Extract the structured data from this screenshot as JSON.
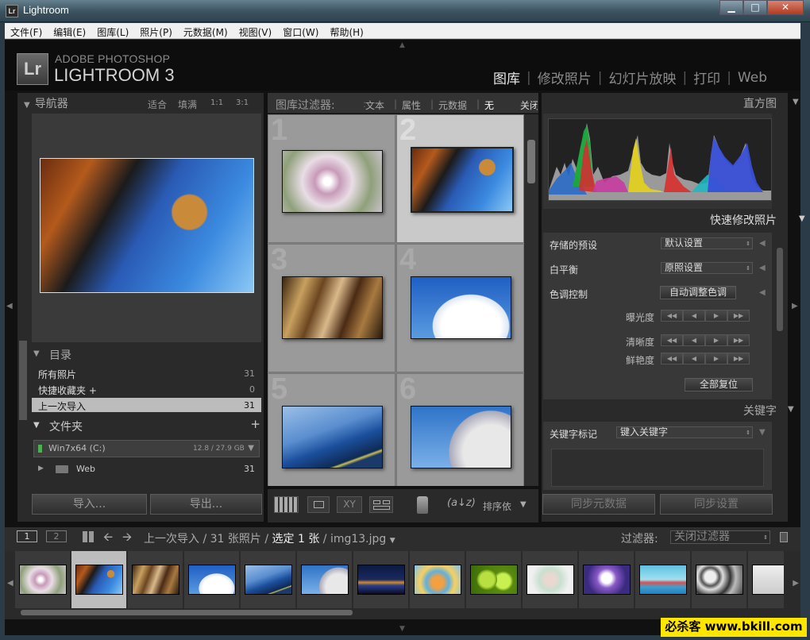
{
  "window": {
    "title": "Lightroom",
    "icon_label": "Lr",
    "min": "▁",
    "max": "□",
    "close": "✕"
  },
  "menu": [
    "文件(F)",
    "编辑(E)",
    "图库(L)",
    "照片(P)",
    "元数据(M)",
    "视图(V)",
    "窗口(W)",
    "帮助(H)"
  ],
  "brand": {
    "logo": "Lr",
    "line1": "ADOBE PHOTOSHOP",
    "line2": "LIGHTROOM 3"
  },
  "modules": [
    {
      "label": "图库",
      "active": true
    },
    {
      "label": "修改照片",
      "active": false
    },
    {
      "label": "幻灯片放映",
      "active": false
    },
    {
      "label": "打印",
      "active": false
    },
    {
      "label": "Web",
      "active": false
    }
  ],
  "navigator": {
    "title": "导航器",
    "opts": [
      "适合",
      "填满",
      "1:1",
      "3:1"
    ]
  },
  "catalog": {
    "title": "目录",
    "items": [
      {
        "label": "所有照片",
        "count": "31"
      },
      {
        "label": "快捷收藏夹 +",
        "count": "0"
      },
      {
        "label": "上一次导入",
        "count": "31"
      }
    ]
  },
  "folders": {
    "title": "文件夹",
    "add": "+",
    "volume": {
      "name": "Win7x64 (C:)",
      "size": "12.8 / 27.9 GB"
    },
    "items": [
      {
        "label": "Web",
        "count": "31"
      }
    ]
  },
  "left_buttons": {
    "import": "导入...",
    "export": "导出..."
  },
  "filterbar": {
    "title": "图库过滤器:",
    "items": [
      "文本",
      "属性",
      "元数据",
      "无"
    ],
    "close": "关闭"
  },
  "grid": {
    "numbers": [
      "1",
      "2",
      "3",
      "4",
      "5",
      "6"
    ]
  },
  "toolbar": {
    "sort_label": "排序依"
  },
  "histogram": {
    "title": "直方图"
  },
  "quick_develop": {
    "title": "快速修改照片",
    "saved_preset_label": "存储的预设",
    "saved_preset_value": "默认设置",
    "wb_label": "白平衡",
    "wb_value": "原照设置",
    "tone_label": "色调控制",
    "auto_tone": "自动调整色调",
    "exposure": "曝光度",
    "clarity": "清晰度",
    "vibrance": "鲜艳度",
    "reset": "全部复位"
  },
  "keywords": {
    "title": "关键字",
    "label": "关键字标记",
    "placeholder": "键入关键字"
  },
  "right_buttons": {
    "sync_meta": "同步元数据",
    "sync_settings": "同步设置"
  },
  "filmstrip_bar": {
    "page1": "1",
    "page2": "2",
    "source": "上一次导入",
    "sep1": "/",
    "count": "31 张照片",
    "sep2": "/",
    "selected": "选定 1 张",
    "sep3": "/",
    "filename": "img13.jpg",
    "filter_label": "过滤器:",
    "filter_value": "关闭过滤器"
  },
  "watermark": "必杀客 www.bkill.com",
  "colors": {
    "panel": "#333333",
    "accent": "#e8e8e8",
    "bg": "#111111"
  }
}
